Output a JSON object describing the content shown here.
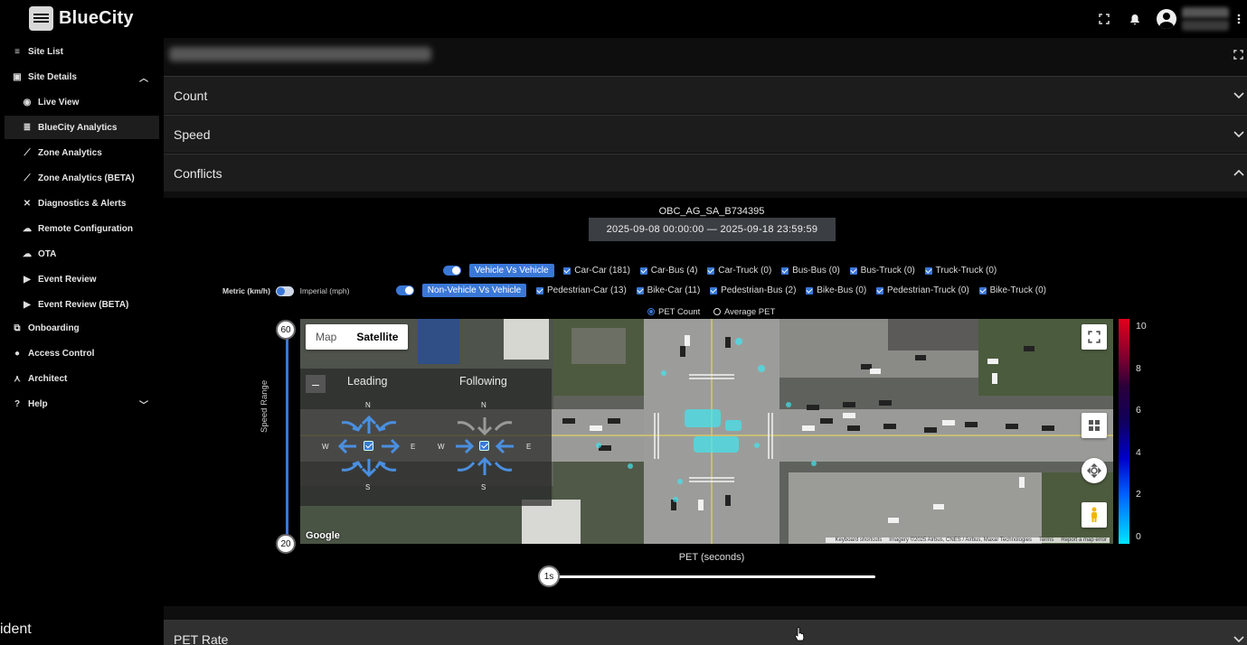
{
  "app": {
    "name": "BlueCity"
  },
  "topbar": {
    "icons": [
      "fullscreen-icon",
      "bell-icon",
      "account-icon",
      "more-vert-icon"
    ]
  },
  "sidebar": {
    "items": [
      {
        "label": "Site List",
        "icon": "menu-icon"
      },
      {
        "label": "Site Details",
        "icon": "dashboard-icon",
        "expanded": true
      },
      {
        "label": "Live View",
        "icon": "eye-icon"
      },
      {
        "label": "BlueCity Analytics",
        "icon": "database-icon",
        "active": true
      },
      {
        "label": "Zone Analytics",
        "icon": "trend-icon"
      },
      {
        "label": "Zone Analytics (BETA)",
        "icon": "trend-beta-icon"
      },
      {
        "label": "Diagnostics & Alerts",
        "icon": "tools-icon"
      },
      {
        "label": "Remote Configuration",
        "icon": "cloud-gear-icon"
      },
      {
        "label": "OTA",
        "icon": "cloud-upload-icon"
      },
      {
        "label": "Event Review",
        "icon": "video-icon"
      },
      {
        "label": "Event Review (BETA)",
        "icon": "video-beta-icon"
      },
      {
        "label": "Onboarding",
        "icon": "flow-icon"
      },
      {
        "label": "Access Control",
        "icon": "user-circle-icon"
      },
      {
        "label": "Architect",
        "icon": "compass-tool-icon"
      },
      {
        "label": "Help",
        "icon": "help-icon",
        "expanded": false
      }
    ],
    "footer_text": "ident"
  },
  "sections": {
    "count": "Count",
    "speed": "Speed",
    "conflicts": "Conflicts",
    "pet_rate": "PET Rate"
  },
  "conflicts": {
    "site_id": "OBC_AG_SA_B734395",
    "date_range": "2025-09-08 00:00:00 — 2025-09-18 23:59:59",
    "vehicle_group": {
      "label": "Vehicle Vs Vehicle",
      "items": [
        "Car-Car (181)",
        "Car-Bus (4)",
        "Car-Truck (0)",
        "Bus-Bus (0)",
        "Bus-Truck (0)",
        "Truck-Truck (0)"
      ]
    },
    "nonvehicle_group": {
      "label": "Non-Vehicle Vs Vehicle",
      "items": [
        "Pedestrian-Car (13)",
        "Bike-Car (11)",
        "Pedestrian-Bus (2)",
        "Bike-Bus (0)",
        "Pedestrian-Truck (0)",
        "Bike-Truck (0)"
      ]
    },
    "units": {
      "metric": "Metric (km/h)",
      "imperial": "Imperial (mph)"
    },
    "mode": {
      "pet_count": "PET Count",
      "average_pet": "Average PET",
      "selected": "PET Count"
    },
    "speed_range": {
      "label": "Speed Range",
      "max": "60",
      "min": "20"
    },
    "map": {
      "tab_map": "Map",
      "tab_satellite": "Satellite",
      "selected_tab": "Satellite",
      "leading": "Leading",
      "following": "Following",
      "dirs": {
        "n": "N",
        "s": "S",
        "e": "E",
        "w": "W"
      },
      "google": "Google",
      "attribution": [
        "Keyboard shortcuts",
        "Imagery ©2025 Airbus, CNES / Airbus, Maxar Technologies",
        "Terms",
        "Report a map error"
      ]
    },
    "legend": [
      "10",
      "8",
      "6",
      "4",
      "2",
      "0"
    ],
    "pet_label": "PET (seconds)",
    "pet_value": "1s"
  }
}
